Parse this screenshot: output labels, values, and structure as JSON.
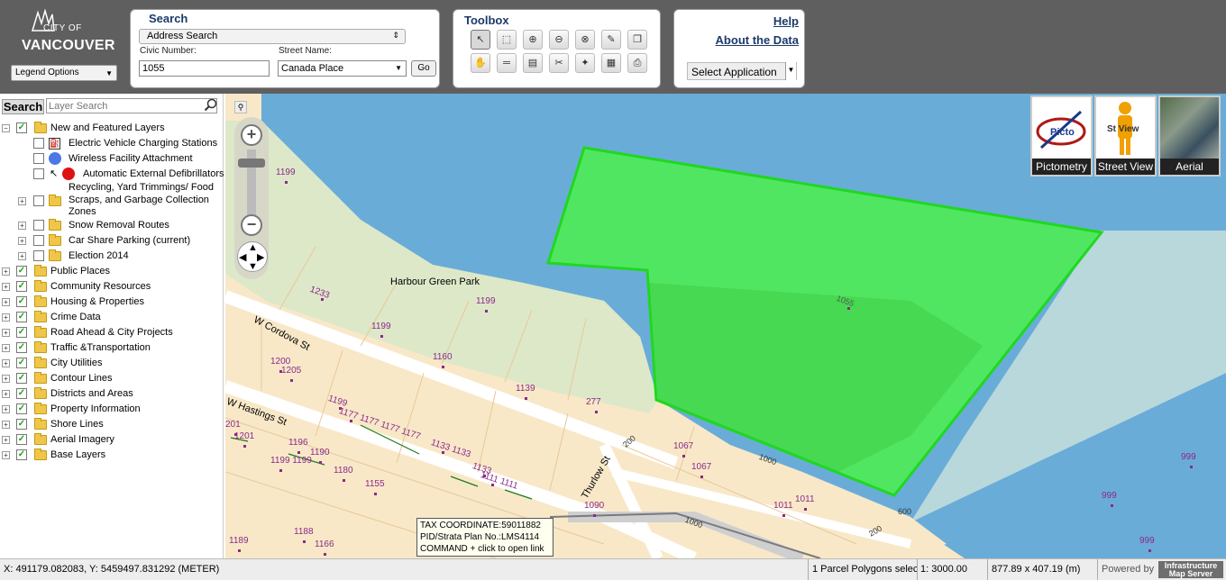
{
  "header": {
    "logo": {
      "line1": "CITY OF",
      "line2": "VANCOUVER"
    },
    "legend_options": "Legend Options"
  },
  "search": {
    "title": "Search",
    "type_selected": "Address Search",
    "civic_label": "Civic Number:",
    "civic_value": "1055",
    "street_label": "Street Name:",
    "street_value": "Canada Place",
    "go_label": "Go"
  },
  "toolbox": {
    "title": "Toolbox",
    "tools": [
      {
        "name": "select-pointer-icon",
        "glyph": "↖"
      },
      {
        "name": "zoom-box-icon",
        "glyph": "⬚"
      },
      {
        "name": "zoom-in-icon",
        "glyph": "⊕"
      },
      {
        "name": "zoom-out-icon",
        "glyph": "⊖"
      },
      {
        "name": "zoom-clear-icon",
        "glyph": "⊗"
      },
      {
        "name": "identify-icon",
        "glyph": "✎"
      },
      {
        "name": "copy-icon",
        "glyph": "❐"
      },
      {
        "name": "pan-hand-icon",
        "glyph": "✋"
      },
      {
        "name": "measure-line-icon",
        "glyph": "═"
      },
      {
        "name": "measure-area-icon",
        "glyph": "▤"
      },
      {
        "name": "clear-tools-icon",
        "glyph": "✂"
      },
      {
        "name": "marker-icon",
        "glyph": "✦"
      },
      {
        "name": "report-icon",
        "glyph": "▦"
      },
      {
        "name": "print-icon",
        "glyph": "⎙"
      }
    ]
  },
  "help": {
    "help_label": "Help",
    "about_label": "About the Data",
    "select_application": "Select Application"
  },
  "layers": {
    "search_button": "Search",
    "search_placeholder": "Layer Search",
    "new_featured": "New and Featured Layers",
    "ev_charging": "Electric Vehicle Charging Stations",
    "wireless": "Wireless Facility Attachment",
    "aed": "Automatic External Defibrillators",
    "recycling_1": "Recycling, Yard Trimmings/ Food",
    "recycling_2": "Scraps, and Garbage Collection",
    "recycling_3": "Zones",
    "snow": "Snow Removal Routes",
    "car_share": "Car Share Parking (current)",
    "election": "Election 2014",
    "public_places": "Public Places",
    "community": "Community Resources",
    "housing": "Housing & Properties",
    "crime": "Crime Data",
    "road_ahead": "Road Ahead & City Projects",
    "traffic": "Traffic &Transportation",
    "utilities": "City Utilities",
    "contour": "Contour Lines",
    "districts": "Districts and Areas",
    "property": "Property Information",
    "shore": "Shore Lines",
    "aerial": "Aerial Imagery",
    "base": "Base Layers"
  },
  "map": {
    "park_label": "Harbour Green Park",
    "street_cordova": "W Cordova St",
    "street_hastings": "W Hastings St",
    "street_thurlow": "Thurlow St",
    "parcels": {
      "p1055": "1055",
      "p1199a": "1199",
      "p1233": "1233",
      "p1199b": "1199",
      "p1199c": "1199",
      "p1160": "1160",
      "p1139": "1139",
      "p277": "277",
      "p1200": "1200",
      "p1205": "1205",
      "p1180": "1180",
      "p1155": "1155",
      "p1067a": "1067",
      "p1067b": "1067",
      "p1011a": "1011",
      "p1011b": "1011",
      "p1090": "1090",
      "p999a": "999",
      "p999b": "999",
      "p999c": "999",
      "p1201": "1201",
      "p2011": "201",
      "p1189": "1189",
      "p1188": "1188",
      "p1166": "1166",
      "p1177": "1177 1177 1177 1177",
      "p1133": "1133 1133",
      "p1111": "1111 1111",
      "p1199row": "1199",
      "p1196": "1196",
      "p1190": "1190",
      "p1199d": "1199 1199",
      "p1133b": "1133",
      "p1000a": "1000",
      "p1000b": "1000",
      "p200a": "200",
      "p200b": "200",
      "p600": "600"
    },
    "thumbs": {
      "pictometry": "Pictometry",
      "street_view": "Street View",
      "aerial": "Aerial",
      "picto_text": "Picto",
      "stview_text": "St View"
    },
    "tooltip": {
      "line1": "TAX COORDINATE:59011882",
      "line2": "PID/Strata Plan No.:LMS4114",
      "line3": "COMMAND + click to open link"
    }
  },
  "status": {
    "coords": "X: 491179.082083, Y: 5459497.831292 (METER)",
    "selection": "1 Parcel Polygons selec",
    "scale": "1: 3000.00",
    "extent": "877.89 x 407.19 (m)",
    "powered_by": "Powered by",
    "ims_line1": "Infrastructure",
    "ims_line2": "Map Server"
  },
  "colors": {
    "water": "#6aacd8",
    "park": "#dde8c8",
    "block": "#f8e8c8",
    "selection": "#4cf04c",
    "header": "#5f5f5f"
  }
}
